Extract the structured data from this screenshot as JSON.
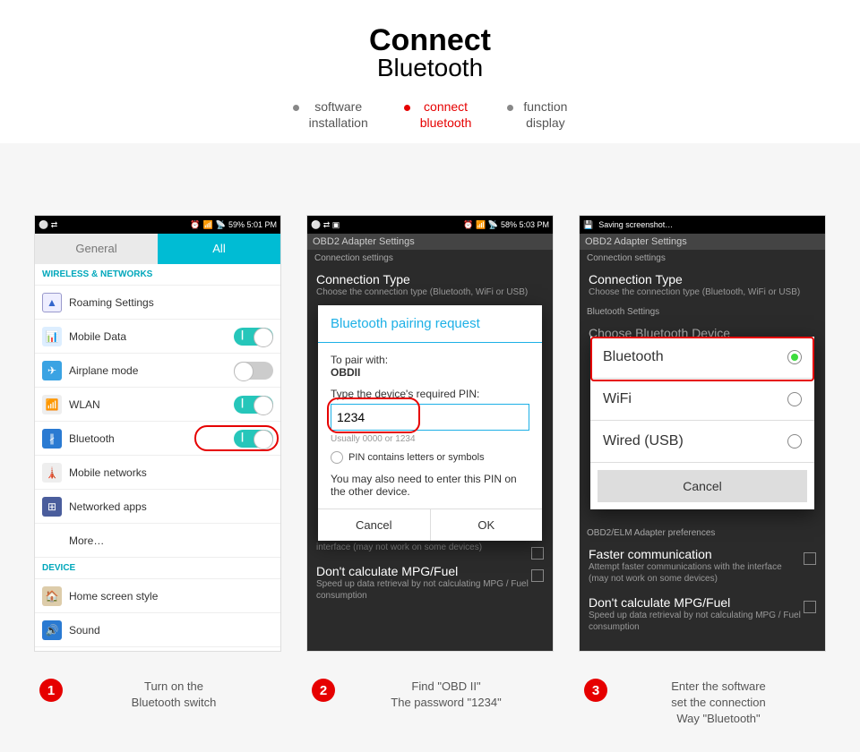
{
  "header": {
    "title": "Connect",
    "subtitle": "Bluetooth"
  },
  "breadcrumb": [
    {
      "l1": "software",
      "l2": "installation",
      "active": false
    },
    {
      "l1": "connect",
      "l2": "bluetooth",
      "active": true
    },
    {
      "l1": "function",
      "l2": "display",
      "active": false
    }
  ],
  "status": {
    "s1": "59%  5:01 PM",
    "s2": "58%  5:03 PM",
    "s3": "Saving screenshot…"
  },
  "shot1": {
    "tabs": {
      "general": "General",
      "all": "All"
    },
    "wireless_hdr": "WIRELESS & NETWORKS",
    "items": [
      {
        "label": "Roaming Settings",
        "toggle": null
      },
      {
        "label": "Mobile Data",
        "toggle": "on"
      },
      {
        "label": "Airplane mode",
        "toggle": "off"
      },
      {
        "label": "WLAN",
        "toggle": "on"
      },
      {
        "label": "Bluetooth",
        "toggle": "on"
      },
      {
        "label": "Mobile networks",
        "toggle": null
      },
      {
        "label": "Networked apps",
        "toggle": null
      },
      {
        "label": "More…",
        "toggle": null
      }
    ],
    "device_hdr": "DEVICE",
    "device_items": [
      "Home screen style",
      "Sound",
      "Display"
    ]
  },
  "app": {
    "title": "OBD2 Adapter Settings",
    "sec1": "Connection settings",
    "conn_t": "Connection Type",
    "conn_s": "Choose the connection type (Bluetooth, WiFi or USB)",
    "bt_hdr": "Bluetooth Settings",
    "choose": "Choose Bluetooth Device",
    "pref": "OBD2/ELM Adapter preferences",
    "fast_t": "Faster communication",
    "fast_s": "Attempt faster communications with the interface (may not work on some devices)",
    "mpg_t": "Don't calculate MPG/Fuel",
    "mpg_s": "Speed up data retrieval by not calculating MPG / Fuel consumption"
  },
  "dlg2": {
    "title": "Bluetooth pairing request",
    "pair_lbl": "To pair with:",
    "device": "OBDII",
    "pin_lbl": "Type the device's required PIN:",
    "pin": "1234",
    "hint": "Usually 0000 or 1234",
    "letters": "PIN contains letters or symbols",
    "note": "You may also need to enter this PIN on the other device.",
    "cancel": "Cancel",
    "ok": "OK"
  },
  "dlg3": {
    "opts": [
      "Bluetooth",
      "WiFi",
      "Wired (USB)"
    ],
    "cancel": "Cancel"
  },
  "captions": [
    {
      "n": "1",
      "text": "Turn on the\nBluetooth switch"
    },
    {
      "n": "2",
      "text": "Find  \"OBD II\"\nThe password \"1234\""
    },
    {
      "n": "3",
      "text": "Enter the software\nset the connection\nWay \"Bluetooth\""
    }
  ]
}
